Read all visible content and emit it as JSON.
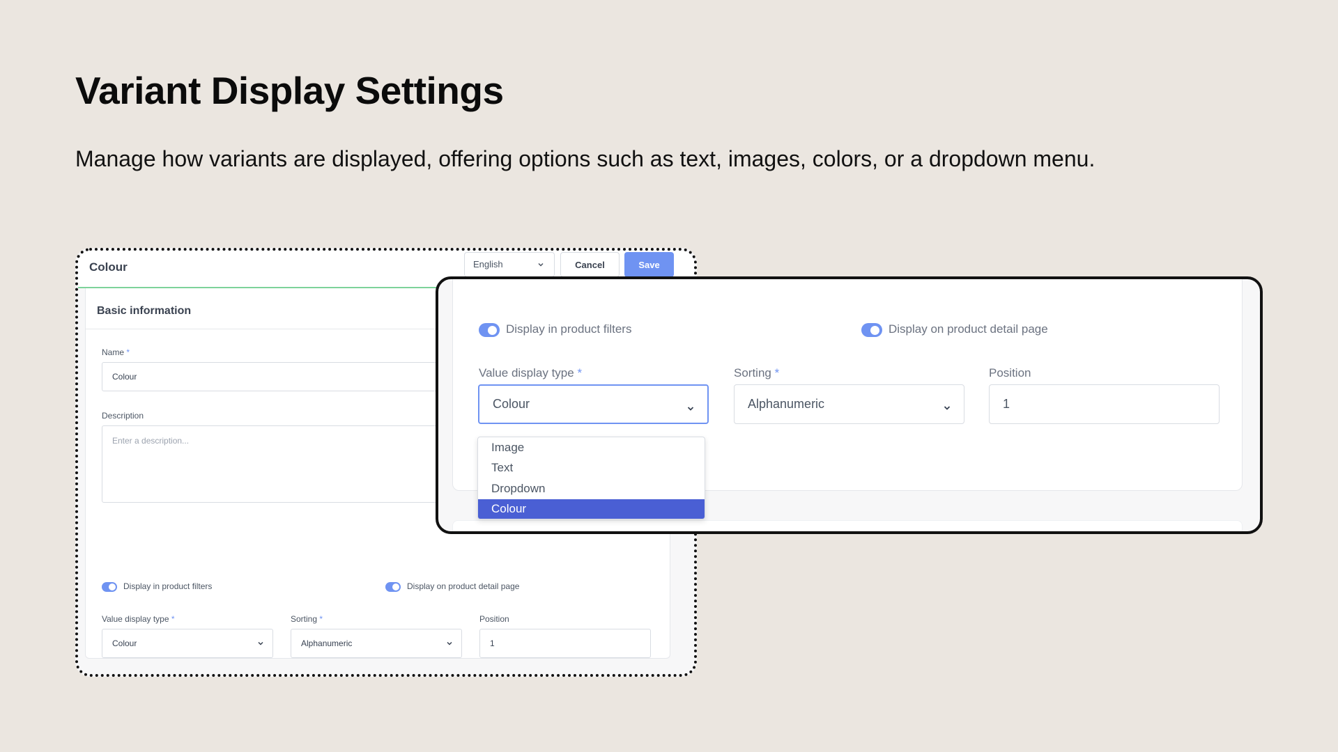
{
  "page": {
    "title": "Variant Display Settings",
    "subtitle": "Manage how variants are displayed, offering options such as text, images, colors, or a dropdown menu."
  },
  "base_panel": {
    "header": {
      "entity_name": "Colour",
      "language": "English",
      "cancel_label": "Cancel",
      "save_label": "Save"
    },
    "section_title": "Basic information",
    "name_field": {
      "label": "Name",
      "required_mark": "*",
      "value": "Colour"
    },
    "description_field": {
      "label": "Description",
      "placeholder": "Enter a description..."
    },
    "toggles": {
      "product_filters": {
        "label": "Display in product filters",
        "on": true
      },
      "product_detail_page": {
        "label": "Display on product detail page",
        "on": true
      }
    },
    "value_display_type": {
      "label": "Value display type",
      "required_mark": "*",
      "value": "Colour"
    },
    "sorting": {
      "label": "Sorting",
      "required_mark": "*",
      "value": "Alphanumeric"
    },
    "position": {
      "label": "Position",
      "value": "1"
    }
  },
  "zoom_panel": {
    "toggles": {
      "product_filters": {
        "label": "Display in product filters",
        "on": true
      },
      "product_detail_page": {
        "label": "Display on product detail page",
        "on": true
      }
    },
    "value_display_type": {
      "label": "Value display type",
      "required_mark": "*",
      "value": "Colour",
      "options": [
        "Image",
        "Text",
        "Dropdown",
        "Colour"
      ],
      "selected_option": "Colour"
    },
    "sorting": {
      "label": "Sorting",
      "required_mark": "*",
      "value": "Alphanumeric"
    },
    "position": {
      "label": "Position",
      "value": "1"
    }
  },
  "colors": {
    "background": "#ebe6e0",
    "accent": "#6f93f2",
    "selected_option": "#4a5fd4",
    "header_underline": "#7dd39a"
  }
}
